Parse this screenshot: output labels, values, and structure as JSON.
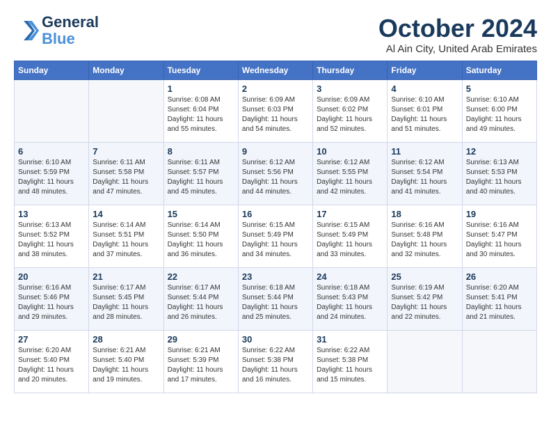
{
  "header": {
    "logo_line1": "General",
    "logo_line2": "Blue",
    "month": "October 2024",
    "location": "Al Ain City, United Arab Emirates"
  },
  "weekdays": [
    "Sunday",
    "Monday",
    "Tuesday",
    "Wednesday",
    "Thursday",
    "Friday",
    "Saturday"
  ],
  "weeks": [
    [
      {
        "day": "",
        "info": ""
      },
      {
        "day": "",
        "info": ""
      },
      {
        "day": "1",
        "info": "Sunrise: 6:08 AM\nSunset: 6:04 PM\nDaylight: 11 hours and 55 minutes."
      },
      {
        "day": "2",
        "info": "Sunrise: 6:09 AM\nSunset: 6:03 PM\nDaylight: 11 hours and 54 minutes."
      },
      {
        "day": "3",
        "info": "Sunrise: 6:09 AM\nSunset: 6:02 PM\nDaylight: 11 hours and 52 minutes."
      },
      {
        "day": "4",
        "info": "Sunrise: 6:10 AM\nSunset: 6:01 PM\nDaylight: 11 hours and 51 minutes."
      },
      {
        "day": "5",
        "info": "Sunrise: 6:10 AM\nSunset: 6:00 PM\nDaylight: 11 hours and 49 minutes."
      }
    ],
    [
      {
        "day": "6",
        "info": "Sunrise: 6:10 AM\nSunset: 5:59 PM\nDaylight: 11 hours and 48 minutes."
      },
      {
        "day": "7",
        "info": "Sunrise: 6:11 AM\nSunset: 5:58 PM\nDaylight: 11 hours and 47 minutes."
      },
      {
        "day": "8",
        "info": "Sunrise: 6:11 AM\nSunset: 5:57 PM\nDaylight: 11 hours and 45 minutes."
      },
      {
        "day": "9",
        "info": "Sunrise: 6:12 AM\nSunset: 5:56 PM\nDaylight: 11 hours and 44 minutes."
      },
      {
        "day": "10",
        "info": "Sunrise: 6:12 AM\nSunset: 5:55 PM\nDaylight: 11 hours and 42 minutes."
      },
      {
        "day": "11",
        "info": "Sunrise: 6:12 AM\nSunset: 5:54 PM\nDaylight: 11 hours and 41 minutes."
      },
      {
        "day": "12",
        "info": "Sunrise: 6:13 AM\nSunset: 5:53 PM\nDaylight: 11 hours and 40 minutes."
      }
    ],
    [
      {
        "day": "13",
        "info": "Sunrise: 6:13 AM\nSunset: 5:52 PM\nDaylight: 11 hours and 38 minutes."
      },
      {
        "day": "14",
        "info": "Sunrise: 6:14 AM\nSunset: 5:51 PM\nDaylight: 11 hours and 37 minutes."
      },
      {
        "day": "15",
        "info": "Sunrise: 6:14 AM\nSunset: 5:50 PM\nDaylight: 11 hours and 36 minutes."
      },
      {
        "day": "16",
        "info": "Sunrise: 6:15 AM\nSunset: 5:49 PM\nDaylight: 11 hours and 34 minutes."
      },
      {
        "day": "17",
        "info": "Sunrise: 6:15 AM\nSunset: 5:49 PM\nDaylight: 11 hours and 33 minutes."
      },
      {
        "day": "18",
        "info": "Sunrise: 6:16 AM\nSunset: 5:48 PM\nDaylight: 11 hours and 32 minutes."
      },
      {
        "day": "19",
        "info": "Sunrise: 6:16 AM\nSunset: 5:47 PM\nDaylight: 11 hours and 30 minutes."
      }
    ],
    [
      {
        "day": "20",
        "info": "Sunrise: 6:16 AM\nSunset: 5:46 PM\nDaylight: 11 hours and 29 minutes."
      },
      {
        "day": "21",
        "info": "Sunrise: 6:17 AM\nSunset: 5:45 PM\nDaylight: 11 hours and 28 minutes."
      },
      {
        "day": "22",
        "info": "Sunrise: 6:17 AM\nSunset: 5:44 PM\nDaylight: 11 hours and 26 minutes."
      },
      {
        "day": "23",
        "info": "Sunrise: 6:18 AM\nSunset: 5:44 PM\nDaylight: 11 hours and 25 minutes."
      },
      {
        "day": "24",
        "info": "Sunrise: 6:18 AM\nSunset: 5:43 PM\nDaylight: 11 hours and 24 minutes."
      },
      {
        "day": "25",
        "info": "Sunrise: 6:19 AM\nSunset: 5:42 PM\nDaylight: 11 hours and 22 minutes."
      },
      {
        "day": "26",
        "info": "Sunrise: 6:20 AM\nSunset: 5:41 PM\nDaylight: 11 hours and 21 minutes."
      }
    ],
    [
      {
        "day": "27",
        "info": "Sunrise: 6:20 AM\nSunset: 5:40 PM\nDaylight: 11 hours and 20 minutes."
      },
      {
        "day": "28",
        "info": "Sunrise: 6:21 AM\nSunset: 5:40 PM\nDaylight: 11 hours and 19 minutes."
      },
      {
        "day": "29",
        "info": "Sunrise: 6:21 AM\nSunset: 5:39 PM\nDaylight: 11 hours and 17 minutes."
      },
      {
        "day": "30",
        "info": "Sunrise: 6:22 AM\nSunset: 5:38 PM\nDaylight: 11 hours and 16 minutes."
      },
      {
        "day": "31",
        "info": "Sunrise: 6:22 AM\nSunset: 5:38 PM\nDaylight: 11 hours and 15 minutes."
      },
      {
        "day": "",
        "info": ""
      },
      {
        "day": "",
        "info": ""
      }
    ]
  ]
}
